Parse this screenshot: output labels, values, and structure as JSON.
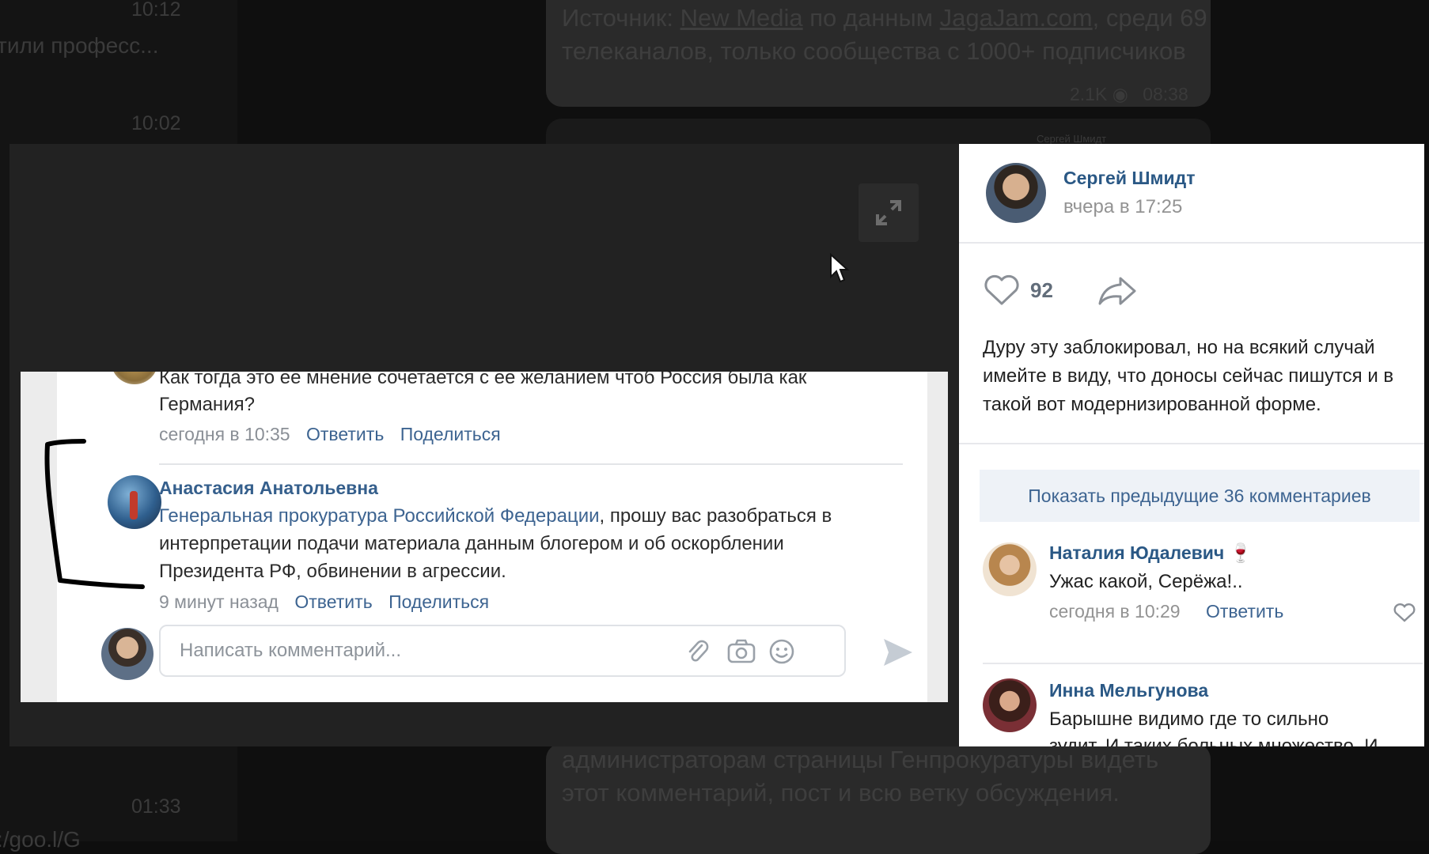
{
  "background_chat": {
    "times": [
      "10:12",
      "10:02",
      "01:33"
    ],
    "chat_preview_text": "тили професс...",
    "chat_preview_bottom": ":/goo.l/G",
    "message_top": {
      "prefix": "Источник: ",
      "link1": "New Media",
      "middle": " по данным ",
      "link2": "JagaJam.com",
      "rest": ", среди 69 телеканалов, только сообщества с 1000+ подписчиков",
      "views": "2.1K",
      "time": "08:38"
    },
    "embedded_author": "Сергей Шмидт",
    "message_bottom": "администраторам страницы Генпрокуратуры видеть этот комментарий, пост и всю ветку обсуждения."
  },
  "screenshot": {
    "prev_comment_text_cut": "Как тогда это ее мнение сочетается с ее желанием чтоб Россия была как",
    "prev_comment_text_end": "Германия?",
    "prev_comment_time": "сегодня в 10:35",
    "reply_label": "Ответить",
    "share_label": "Поделиться",
    "comment": {
      "author": "Анастасия Анатольевна",
      "link": "Генеральная прокуратура Российской Федерации",
      "text_line1_rest": ", прошу вас разобраться в",
      "text_line2": "интерпретации подачи материала данным блогером и об оскорблении",
      "text_line3": "Президента РФ, обвинении в агрессии.",
      "time": "9 минут назад"
    },
    "input_placeholder": "Написать комментарий..."
  },
  "post": {
    "author": "Сергей Шмидт",
    "date": "вчера в 17:25",
    "likes": "92",
    "text": "Дуру эту заблокировал, но на всякий случай имейте в виду, что доносы сейчас пишутся и в такой вот модернизированной форме.",
    "show_previous": "Показать предыдущие 36 комментариев",
    "comments": [
      {
        "author": "Наталия Юдалевич",
        "emoji": "🍷",
        "text": "Ужас какой, Серёжа!..",
        "time": "сегодня в 10:29",
        "reply": "Ответить"
      },
      {
        "author": "Инна Мельгунова",
        "text": "Барышне видимо где то сильно",
        "text_cut": "зудит. И таких больных множество. И"
      }
    ]
  },
  "colors": {
    "vk_link": "#3d6491",
    "vk_author": "#2a5885",
    "overlay": "#1f1f1f"
  }
}
